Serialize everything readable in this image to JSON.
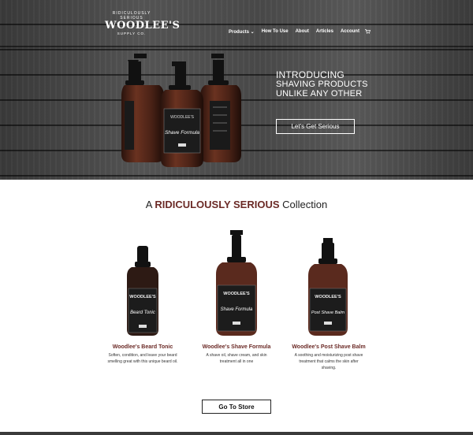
{
  "header": {
    "logo": {
      "tagline": "RIDICULOUSLY SERIOUS",
      "brand": "WOODLEE'S",
      "subtitle": "SUPPLY CO."
    },
    "nav": [
      {
        "label": "Products ⌄"
      },
      {
        "label": "How To Use"
      },
      {
        "label": "About"
      },
      {
        "label": "Articles"
      },
      {
        "label": "Account"
      }
    ],
    "cart_icon": "shopping-cart-icon"
  },
  "hero": {
    "line1": "INTRODUCING",
    "line2": "SHAVING PRODUCTS",
    "line3": "UNLIKE ANY OTHER",
    "cta_label": "Let's Get Serious",
    "bottle_label": "Shave Formula"
  },
  "collection": {
    "title_prefix": "A",
    "title_emphasis": "RIDICULOUSLY SERIOUS",
    "title_suffix": "Collection",
    "products": [
      {
        "name": "Woodlee's Beard Tonic",
        "label": "Beard Tonic",
        "desc_lines": [
          "Soften, condition, and leave your beard",
          "smelling great with this unique beard oil."
        ]
      },
      {
        "name": "Woodlee's Shave Formula",
        "label": "Shave Formula",
        "desc_lines": [
          "A shave oil, shave cream, and skin",
          "treatment all in one"
        ]
      },
      {
        "name": "Woodlee's Post Shave Balm",
        "label": "Post Shave Balm",
        "desc_lines": [
          "A soothing and moisturizing post shave",
          "treatment that calms the skin after",
          "shaving."
        ]
      }
    ],
    "store_button": "Go To Store"
  },
  "colors": {
    "accent": "#6b2a26",
    "bottle": "#5a2a1e"
  }
}
